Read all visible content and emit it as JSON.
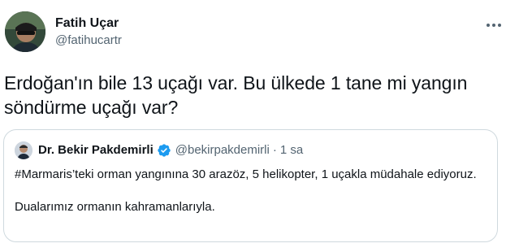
{
  "author": {
    "name": "Fatih Uçar",
    "handle": "@fatihucartr"
  },
  "tweet": {
    "text": "Erdoğan'ın bile 13 uçağı var. Bu ülkede 1 tane mi yangın söndürme uçağı var?"
  },
  "quoted_tweet": {
    "name": "Dr. Bekir Pakdemirli",
    "handle": "@bekirpakdemirli",
    "separator": "·",
    "time": "1 sa",
    "paragraph1": "#Marmaris’teki orman yangınına 30 arazöz, 5 helikopter, 1 uçakla müdahale ediyoruz.",
    "paragraph2": "Dualarımız ormanın kahramanlarıyla."
  },
  "icons": {
    "more": "more-horizontal-icon",
    "verified": "verified-badge-icon"
  },
  "colors": {
    "text_primary": "#0f1419",
    "text_secondary": "#536471",
    "verified_blue": "#1d9bf0",
    "card_border": "#cfd9de"
  }
}
